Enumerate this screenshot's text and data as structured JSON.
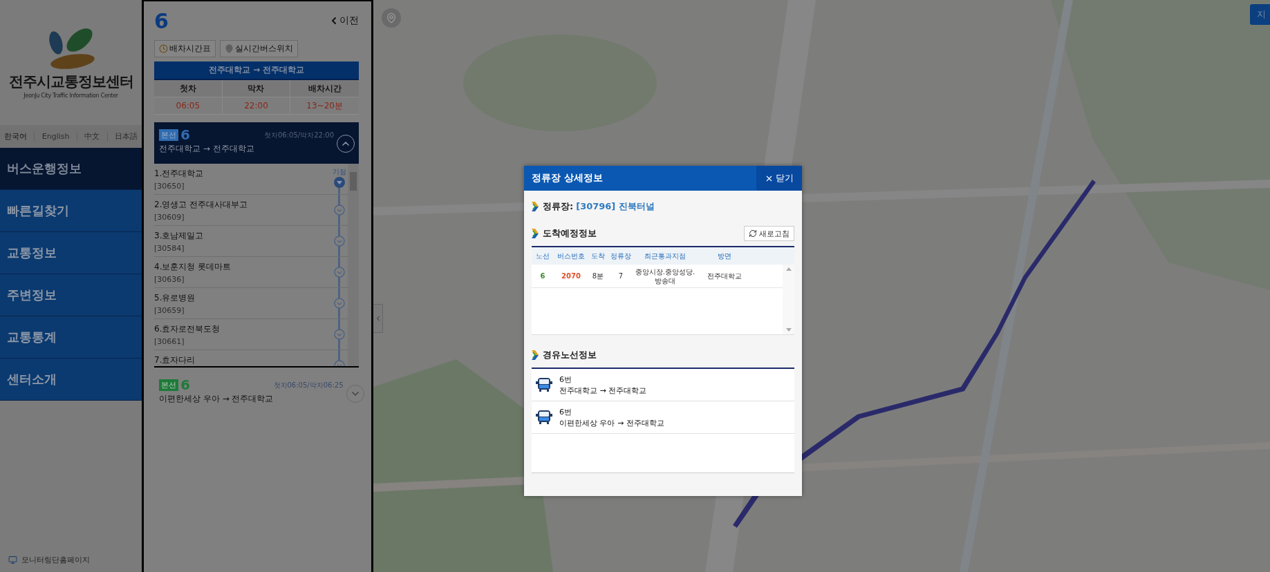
{
  "sidebar": {
    "logo_title": "전주시교통정보센터",
    "logo_subtitle": "JeonJu City Traffic Information Center",
    "languages": [
      {
        "label": "한국어",
        "selected": true
      },
      {
        "label": "English",
        "selected": false
      },
      {
        "label": "中文",
        "selected": false
      },
      {
        "label": "日本語",
        "selected": false
      }
    ],
    "menu": [
      {
        "label": "버스운행정보",
        "selected": true
      },
      {
        "label": "빠른길찾기",
        "selected": false
      },
      {
        "label": "교통정보",
        "selected": false
      },
      {
        "label": "주변정보",
        "selected": false
      },
      {
        "label": "교통통계",
        "selected": false
      },
      {
        "label": "센터소개",
        "selected": false
      }
    ],
    "footer_link": "모니터링단홈페이지"
  },
  "route_panel": {
    "route_number": "6",
    "back": "이전",
    "buttons": [
      {
        "kind": "timetable",
        "label": "배차시간표"
      },
      {
        "kind": "location",
        "label": "실시간버스위치"
      }
    ],
    "direction": "전주대학교 → 전주대학교",
    "schedule": {
      "columns": [
        "첫차",
        "막차",
        "배차시간"
      ],
      "values": [
        "06:05",
        "22:00",
        "13~20분"
      ]
    },
    "routes": [
      {
        "badge": "본선",
        "number": "6",
        "times": "첫차06:05/막차22:00",
        "path": "전주대학교 → 전주대학교",
        "expanded": true,
        "color": "#2f6bb0",
        "stops": [
          {
            "kind": "start",
            "label": "기점",
            "name": "1.전주대학교",
            "code": "[30650]"
          },
          {
            "kind": "stop",
            "name": "2.영생고 전주대사대부고",
            "code": "[30609]"
          },
          {
            "kind": "stop",
            "name": "3.호남제일고",
            "code": "[30584]"
          },
          {
            "kind": "stop",
            "name": "4.보훈지청 롯데마트",
            "code": "[30636]"
          },
          {
            "kind": "stop",
            "name": "5.유로병원",
            "code": "[30659]"
          },
          {
            "kind": "stop",
            "name": "6.효자로전북도청",
            "code": "[30661]"
          },
          {
            "kind": "stop",
            "name": "7.효자다리"
          }
        ]
      },
      {
        "badge": "본선",
        "number": "6",
        "times": "첫차06:05/막차06:25",
        "path": "이편한세상 우아 → 전주대학교",
        "expanded": false,
        "color": "#1f7a3a"
      }
    ]
  },
  "map": {
    "kind": "picture",
    "layer_button": "지"
  },
  "modal": {
    "title": "정류장 상세정보",
    "close": "닫기",
    "stop_label": "정류장:",
    "stop_value": "[30796] 진북터널",
    "arrival": {
      "title": "도착예정정보",
      "refresh": "새로고침",
      "columns": [
        "노선",
        "버스번호",
        "도착",
        "정류장",
        "최근통과지점",
        "방면"
      ],
      "rows": [
        [
          "6",
          "2070",
          "8분",
          "7",
          "중앙시장.중앙성당.방송대",
          "전주대학교"
        ]
      ]
    },
    "routes_title": "경유노선정보",
    "routes": [
      {
        "number": "6번",
        "path": "전주대학교 → 전주대학교"
      },
      {
        "number": "6번",
        "path": "이편한세상 우아 → 전주대학교"
      }
    ]
  }
}
